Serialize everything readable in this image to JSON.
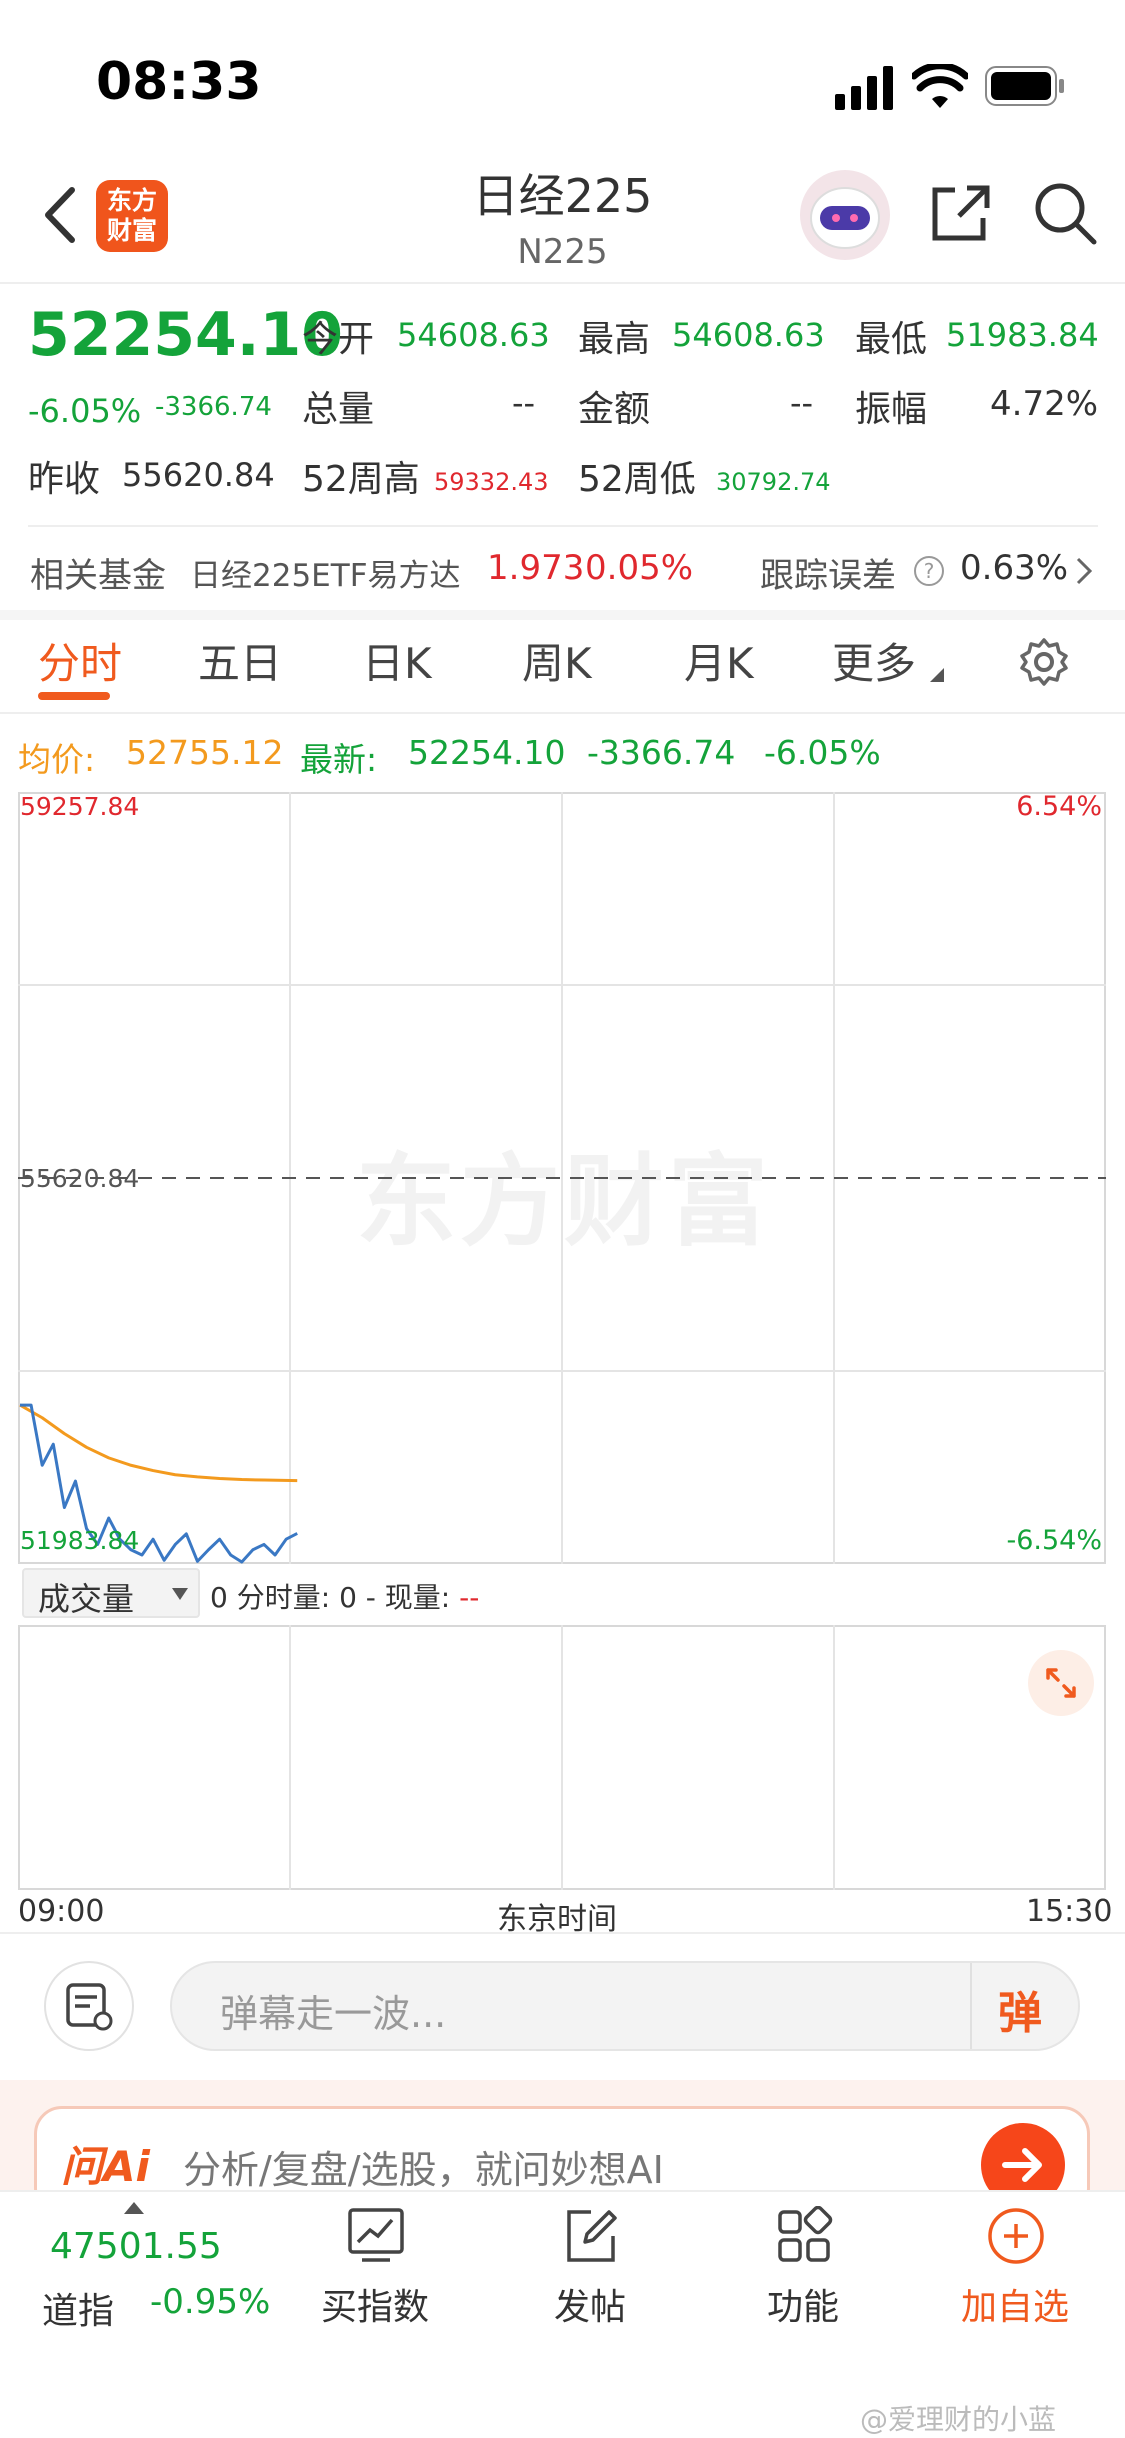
{
  "status_bar": {
    "time": "08:33"
  },
  "header": {
    "logo_text_1": "东方",
    "logo_text_2": "财富",
    "title": "日经225",
    "subtitle": "N225"
  },
  "quote": {
    "price": "52254.10",
    "change_pct": "-6.05%",
    "change": "-3366.74",
    "open_label": "今开",
    "open": "54608.63",
    "high_label": "最高",
    "high": "54608.63",
    "low_label": "最低",
    "low": "51983.84",
    "volume_label": "总量",
    "volume": "--",
    "amount_label": "金额",
    "amount": "--",
    "amplitude_label": "振幅",
    "amplitude": "4.72%",
    "prev_close_label": "昨收",
    "prev_close": "55620.84",
    "w52_high_label": "52周高",
    "w52_high": "59332.43",
    "w52_low_label": "52周低",
    "w52_low": "30792.74"
  },
  "fund": {
    "label": "相关基金",
    "name": "日经225ETF易方达",
    "price": "1.973",
    "pct": "0.05%",
    "tracking_label": "跟踪误差",
    "tracking_value": "0.63%"
  },
  "tabs": [
    "分时",
    "五日",
    "日K",
    "周K",
    "月K",
    "更多"
  ],
  "chart_info": {
    "avg_label": "均价:",
    "avg_value": "52755.12",
    "latest_label": "最新:",
    "latest_value": "52254.10",
    "latest_change": "-3366.74",
    "latest_pct": "-6.05%"
  },
  "chart_data": {
    "type": "line",
    "y_top_label": "59257.84",
    "y_mid_label": "55620.84",
    "y_bottom_label": "51983.84",
    "pct_top": "6.54%",
    "pct_bottom": "-6.54%",
    "ylim": [
      51983.84,
      59257.84
    ],
    "reference": 55620.84,
    "x_start": "09:00",
    "x_mid": "东京时间",
    "x_end": "15:30",
    "series": [
      {
        "name": "最新",
        "color": "#3a78c4",
        "x": [
          0,
          1,
          2,
          3,
          4,
          5,
          6,
          7,
          8,
          9,
          10,
          11,
          12,
          13,
          14,
          15,
          16,
          17,
          18,
          19,
          20,
          21,
          22,
          23,
          24,
          25
        ],
        "values": [
          53470,
          53470,
          52900,
          53100,
          52500,
          52750,
          52300,
          52150,
          52400,
          52200,
          52100,
          52050,
          52200,
          52000,
          52150,
          52250,
          51990,
          52100,
          52200,
          52050,
          51984,
          52100,
          52150,
          52050,
          52200,
          52254
        ]
      },
      {
        "name": "均价",
        "color": "#f39a1e",
        "x": [
          0,
          2,
          4,
          6,
          8,
          10,
          12,
          14,
          16,
          18,
          20,
          22,
          25
        ],
        "values": [
          53470,
          53350,
          53200,
          53070,
          52970,
          52900,
          52850,
          52810,
          52790,
          52775,
          52765,
          52760,
          52755
        ]
      }
    ]
  },
  "volume": {
    "selector": "成交量",
    "text_a": "0",
    "text_b": "分时量: 0",
    "text_c": "现量:",
    "text_d": "--"
  },
  "comment": {
    "placeholder": "弹幕走一波...",
    "send_label": "弹"
  },
  "ai": {
    "brand": "问Ai",
    "placeholder": "分析/复盘/选股，就问妙想AI"
  },
  "bottom_bar": {
    "index_value": "47501.55",
    "index_name": "道指",
    "index_pct": "-0.95%",
    "buy_index": "买指数",
    "post": "发帖",
    "functions": "功能",
    "add_watch": "加自选"
  },
  "watermark": "东方财富",
  "footer_watermark": "@爱理财的小蓝"
}
